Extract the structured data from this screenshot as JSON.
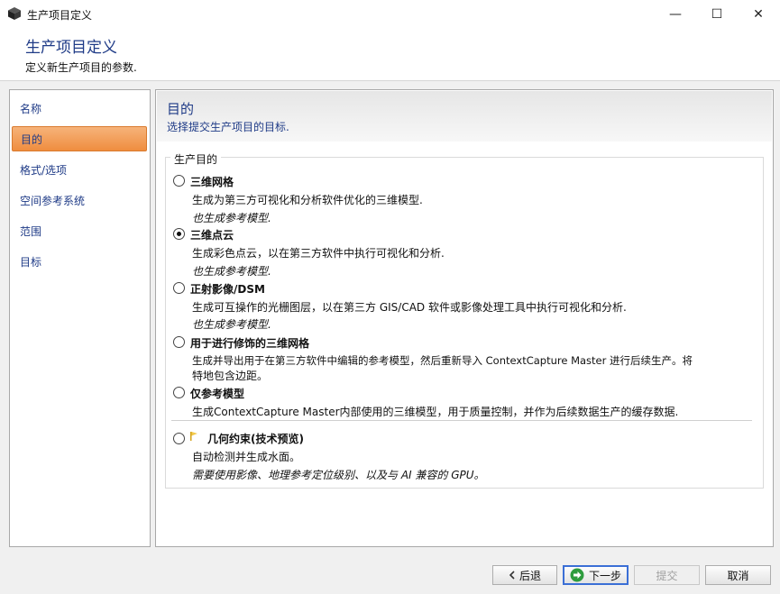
{
  "window": {
    "title": "生产项目定义",
    "minimize_glyph": "—",
    "maximize_glyph": "☐",
    "close_glyph": "✕"
  },
  "header": {
    "title": "生产项目定义",
    "subtitle": "定义新生产项目的参数."
  },
  "sidebar": {
    "items": [
      {
        "label": "名称",
        "active": false
      },
      {
        "label": "目的",
        "active": true
      },
      {
        "label": "格式/选项",
        "active": false
      },
      {
        "label": "空间参考系统",
        "active": false
      },
      {
        "label": "范围",
        "active": false
      },
      {
        "label": "目标",
        "active": false
      }
    ]
  },
  "main": {
    "title": "目的",
    "subtitle": "选择提交生产项目的目标.",
    "group_label": "生产目的",
    "options": [
      {
        "title": "三维网格",
        "desc": "生成为第三方可视化和分析软件优化的三维模型.",
        "note": "也生成参考模型.",
        "checked": false
      },
      {
        "title": "三维点云",
        "desc": "生成彩色点云，以在第三方软件中执行可视化和分析.",
        "note": "也生成参考模型.",
        "checked": true
      },
      {
        "title": "正射影像/DSM",
        "desc": "生成可互操作的光栅图层，以在第三方 GIS/CAD 软件或影像处理工具中执行可视化和分析.",
        "note": "也生成参考模型.",
        "checked": false
      },
      {
        "title": "用于进行修饰的三维网格",
        "desc": "生成并导出用于在第三方软件中编辑的参考模型，然后重新导入 ContextCapture Master 进行后续生产。将",
        "desc2": "特地包含边距。",
        "checked": false
      },
      {
        "title": "仅参考模型",
        "desc": "生成ContextCapture Master内部使用的三维模型，用于质量控制，并作为后续数据生产的缓存数据.",
        "checked": false
      },
      {
        "title": "几何约束(技术预览)",
        "desc": "自动检测并生成水面。",
        "note": "需要使用影像、地理参考定位级别、以及与 AI 兼容的 GPU。",
        "checked": false
      }
    ]
  },
  "footer": {
    "back_label": "后退",
    "next_label": "下一步",
    "submit_label": "提交",
    "cancel_label": "取消"
  },
  "colors": {
    "accent": "#1f3b87",
    "active_item": "#ef8d3f",
    "next_icon": "#2e9c3e"
  }
}
